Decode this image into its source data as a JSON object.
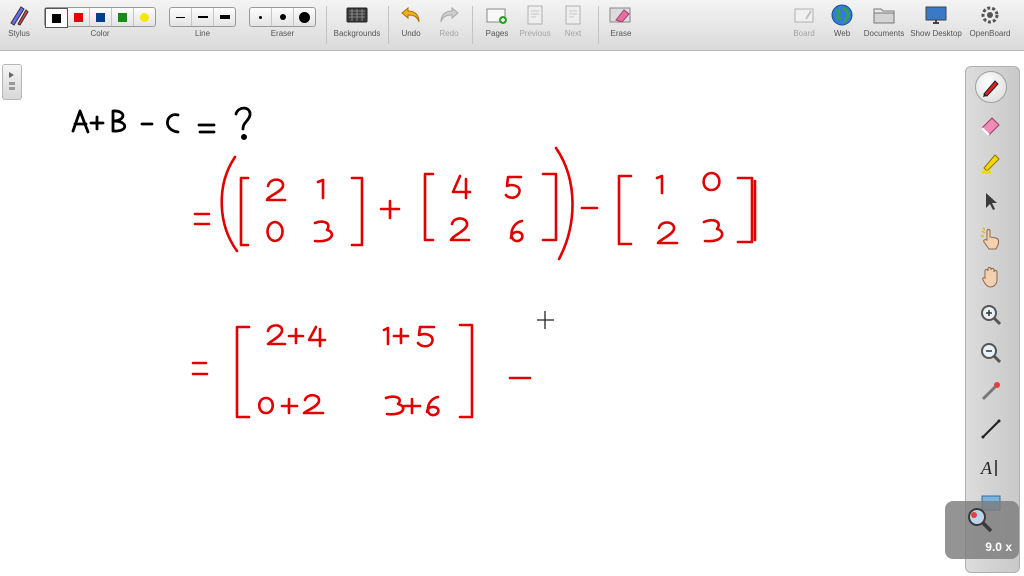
{
  "toolbar": {
    "stylus": "Stylus",
    "color": "Color",
    "line": "Line",
    "eraser": "Eraser",
    "backgrounds": "Backgrounds",
    "undo": "Undo",
    "redo": "Redo",
    "pages": "Pages",
    "previous": "Previous",
    "next": "Next",
    "erase": "Erase",
    "board": "Board",
    "web": "Web",
    "documents": "Documents",
    "show_desktop": "Show Desktop",
    "openboard": "OpenBoard",
    "colors": [
      "#000000",
      "#e30000",
      "#003f8c",
      "#1a8a1a",
      "#f5e800"
    ]
  },
  "ink": {
    "color": "#e00000",
    "question_color": "#000000"
  },
  "zoom": {
    "value": "9.0 x"
  },
  "icons": {
    "side_tools": [
      "pen-icon",
      "marker-icon",
      "highlighter-icon",
      "selector-icon",
      "interact-icon",
      "hand-icon",
      "zoom-in-icon",
      "zoom-out-icon",
      "laser-pointer-icon",
      "line-icon",
      "text-icon",
      "capture-icon"
    ]
  }
}
